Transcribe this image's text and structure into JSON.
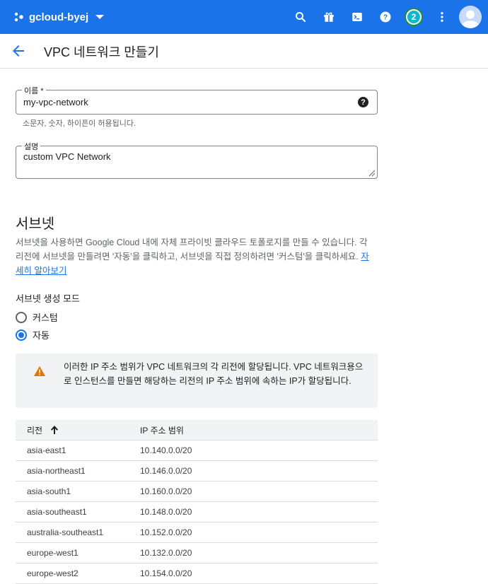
{
  "topbar": {
    "project": "gcloud-byej",
    "notification_count": "2",
    "icons": [
      "search-icon",
      "gift-icon",
      "cloud-shell-icon",
      "help-icon",
      "more-vert-icon",
      "avatar"
    ]
  },
  "header": {
    "title": "VPC 네트워크 만들기"
  },
  "form": {
    "name_label": "이름 *",
    "name_value": "my-vpc-network",
    "name_hint": "소문자, 숫자, 하이픈이 허용됩니다.",
    "desc_label": "설명",
    "desc_value": "custom VPC Network"
  },
  "subnets": {
    "title": "서브넷",
    "description": "서브넷을 사용하면 Google Cloud 내에 자체 프라이빗 클라우드 토폴로지를 만들 수 있습니다. 각 리전에 서브넷을 만들려면 '자동'을 클릭하고, 서브넷을 직접 정의하려면 '커스텀'을 클릭하세요.",
    "learn_more": "자세히 알아보기",
    "mode_title": "서브넷 생성 모드",
    "mode_options": [
      "커스텀",
      "자동"
    ],
    "selected_mode": "자동",
    "notice": "이러한 IP 주소 범위가 VPC 네트워크의 각 리전에 할당됩니다. VPC 네트워크용으로 인스턴스를 만들면 해당하는 리전의 IP 주소 범위에 속하는 IP가 할당됩니다."
  },
  "table": {
    "headers": [
      "리전",
      "IP 주소 범위"
    ],
    "rows": [
      [
        "asia-east1",
        "10.140.0.0/20"
      ],
      [
        "asia-northeast1",
        "10.146.0.0/20"
      ],
      [
        "asia-south1",
        "10.160.0.0/20"
      ],
      [
        "asia-southeast1",
        "10.148.0.0/20"
      ],
      [
        "australia-southeast1",
        "10.152.0.0/20"
      ],
      [
        "europe-west1",
        "10.132.0.0/20"
      ],
      [
        "europe-west2",
        "10.154.0.0/20"
      ]
    ]
  },
  "colors": {
    "topbar": "#1a73e8",
    "accent": "#1a73e8",
    "warning": "#e37400"
  }
}
